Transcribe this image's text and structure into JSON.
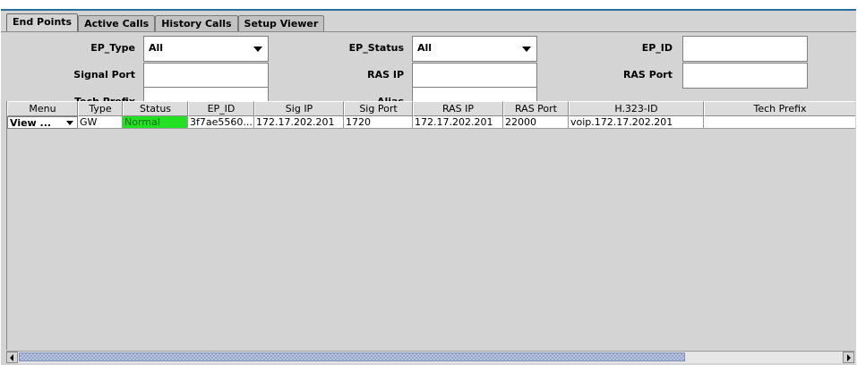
{
  "tabs": [
    {
      "label": "End Points",
      "active": true
    },
    {
      "label": "Active Calls",
      "active": false
    },
    {
      "label": "History Calls",
      "active": false
    },
    {
      "label": "Setup Viewer",
      "active": false
    }
  ],
  "filters": {
    "ep_type_label": "EP_Type",
    "ep_type_value": "All",
    "ep_status_label": "EP_Status",
    "ep_status_value": "All",
    "ep_id_label": "EP_ID",
    "ep_id_value": "",
    "signal_port_label": "Signal Port",
    "signal_port_value": "",
    "ras_ip_label": "RAS IP",
    "ras_ip_value": "",
    "ras_port_label": "RAS Port",
    "ras_port_value": "",
    "tech_prefix_label": "Tech Prefix",
    "tech_prefix_value": "",
    "alias_label": "Alias",
    "alias_value": ""
  },
  "table": {
    "columns": [
      "Menu",
      "Type",
      "Status",
      "EP_ID",
      "Sig IP",
      "Sig Port",
      "RAS IP",
      "RAS Port",
      "H.323-ID",
      "Tech Prefix"
    ],
    "rows": [
      {
        "menu": "View ...",
        "type": "GW",
        "status": "Normal",
        "ep_id": "3f7ae5560...",
        "sig_ip": "172.17.202.201",
        "sig_port": "1720",
        "ras_ip": "172.17.202.201",
        "ras_port": "22000",
        "h323_id": "voip.172.17.202.201",
        "tech_prefix": ""
      }
    ]
  },
  "colors": {
    "status_normal": "#22e022",
    "tab_border_accent": "#2a6f9f"
  },
  "scrollbar": {
    "thumb_fraction": 0.81
  }
}
